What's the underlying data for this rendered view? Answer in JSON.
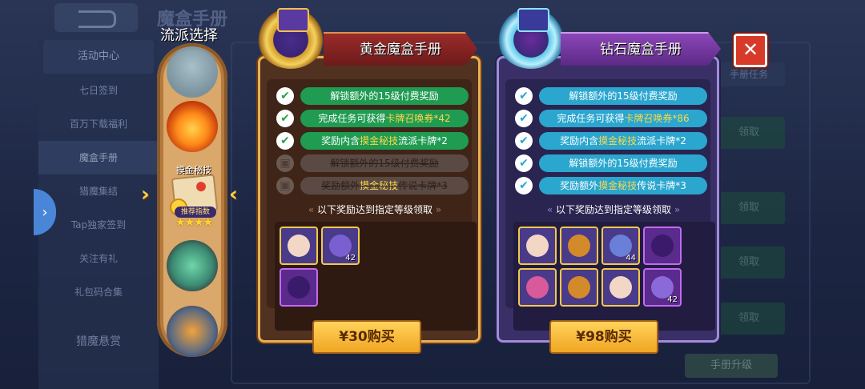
{
  "background": {
    "title": "魔盒手册",
    "menu": {
      "header": "活动中心",
      "items": [
        "七日签到",
        "百万下载福利",
        "魔盒手册",
        "猎魔集结",
        "Tap独家签到",
        "关注有礼",
        "礼包码合集",
        "猎魔悬赏"
      ]
    },
    "right_buttons": [
      "领取",
      "领取",
      "领取",
      "领取",
      "领取"
    ],
    "right_header": "手册任务",
    "footer_button": "手册升级"
  },
  "selector": {
    "title": "流派选择",
    "selected_label": "摸金秘技",
    "recommend_label": "推荐指数",
    "stars": "★★★★"
  },
  "gold_card": {
    "title": "黄金魔盒手册",
    "features": [
      {
        "parts": [
          "解锁额外的15级付费奖励"
        ],
        "locked": false
      },
      {
        "parts": [
          "完成任务可获得",
          "卡牌召唤券*42"
        ],
        "locked": false
      },
      {
        "parts": [
          "奖励内含",
          "摸金秘技",
          "流派卡牌*2"
        ],
        "locked": false
      },
      {
        "parts": [
          "解锁额外的15级付费奖励"
        ],
        "locked": true
      },
      {
        "parts": [
          "奖励额外",
          "摸金秘技",
          "传说卡牌*3"
        ],
        "locked": true
      }
    ],
    "note": "以下奖励达到指定等级领取",
    "rewards": [
      {
        "count": "",
        "style": "gold"
      },
      {
        "count": "42",
        "style": "gold"
      },
      {
        "count": "",
        "style": "purple"
      }
    ],
    "price": "¥30购买"
  },
  "diamond_card": {
    "title": "钻石魔盒手册",
    "features": [
      {
        "parts": [
          "解锁额外的15级付费奖励"
        ],
        "locked": false
      },
      {
        "parts": [
          "完成任务可获得",
          "卡牌召唤券*86"
        ],
        "locked": false
      },
      {
        "parts": [
          "奖励内含",
          "摸金秘技",
          "流派卡牌*2"
        ],
        "locked": false
      },
      {
        "parts": [
          "解锁额外的15级付费奖励"
        ],
        "locked": false
      },
      {
        "parts": [
          "奖励额外",
          "摸金秘技",
          "传说卡牌*3"
        ],
        "locked": false
      }
    ],
    "note": "以下奖励达到指定等级领取",
    "rewards": [
      {
        "count": "",
        "style": "gold"
      },
      {
        "count": "",
        "style": "gold"
      },
      {
        "count": "44",
        "style": "gold"
      },
      {
        "count": "",
        "style": "purple"
      },
      {
        "count": "",
        "style": "gold"
      },
      {
        "count": "",
        "style": "gold"
      },
      {
        "count": "",
        "style": "gold"
      },
      {
        "count": "42",
        "style": "purple"
      }
    ],
    "price": "¥98购买"
  },
  "colors": {
    "gold_feature": "#1f9b52",
    "diamond_feature": "#2aa6cf",
    "highlight": "#ffd84a",
    "buy_button": "#f0a524",
    "close": "#d83a2a"
  },
  "icons": {
    "close": "close-icon",
    "check": "check-icon",
    "lock": "lock-icon",
    "side_toggle": "chevron-right-icon"
  }
}
